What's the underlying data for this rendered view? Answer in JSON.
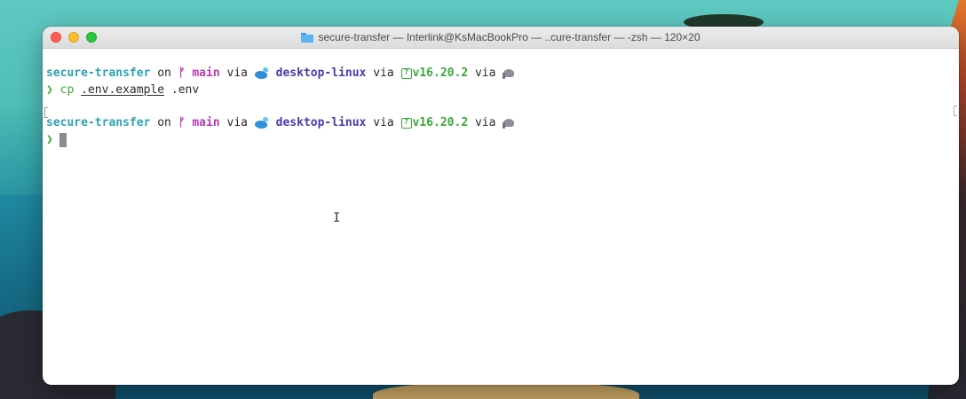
{
  "window": {
    "title": "secure-transfer — Interlink@KsMacBookPro — ..cure-transfer — -zsh — 120×20"
  },
  "terminal": {
    "lines": [
      {
        "type": "prompt",
        "dir": "secure-transfer",
        "on": " on ",
        "branch_glyph": "ᚠ",
        "branch": "main",
        "via1": " via ",
        "docker_icon": "whale-icon",
        "context": "desktop-linux",
        "via2": " via ",
        "node_icon_glyph": "?",
        "node_version": "v16.20.2",
        "via3": " via ",
        "php_icon": "elephant-icon"
      },
      {
        "type": "command",
        "prompt_char": "❯",
        "cmd": "cp",
        "arg1": ".env.example",
        "arg2": ".env"
      },
      {
        "type": "prompt",
        "dir": "secure-transfer",
        "on": " on ",
        "branch_glyph": "ᚠ",
        "branch": "main",
        "via1": " via ",
        "docker_icon": "whale-icon",
        "context": "desktop-linux",
        "via2": " via ",
        "node_icon_glyph": "?",
        "node_version": "v16.20.2",
        "via3": " via ",
        "php_icon": "elephant-icon"
      },
      {
        "type": "input",
        "prompt_char": "❯"
      }
    ]
  },
  "colors": {
    "dir": "#2ea2b2",
    "branch": "#b63cb8",
    "context": "#4a3aa8",
    "node": "#3aa83a",
    "prompt": "#3aa83a"
  }
}
